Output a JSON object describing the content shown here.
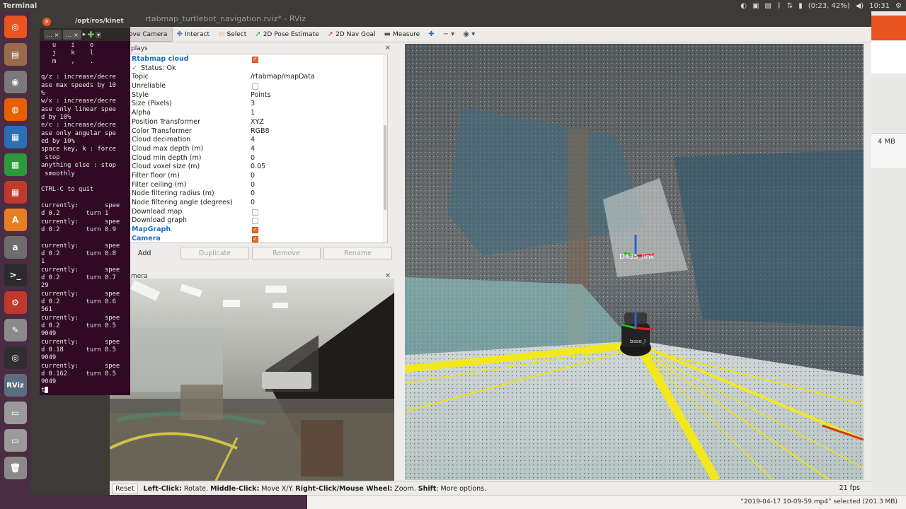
{
  "top_panel": {
    "app_name": "Terminal",
    "battery": "(0:23, 42%)",
    "clock": "10:31"
  },
  "launcher": {
    "items": [
      {
        "name": "ubuntu-logo-icon",
        "glyph": "◎",
        "color": "#e95420"
      },
      {
        "name": "files-icon",
        "glyph": "▤",
        "color": "#9a6b4b"
      },
      {
        "name": "screenshot-icon",
        "glyph": "◉",
        "color": "#7a7a7a"
      },
      {
        "name": "firefox-icon",
        "glyph": "◍",
        "color": "#e66000"
      },
      {
        "name": "writer-icon",
        "glyph": "▦",
        "color": "#2a6fb5"
      },
      {
        "name": "calc-icon",
        "glyph": "▦",
        "color": "#2c9a3a"
      },
      {
        "name": "impress-icon",
        "glyph": "▦",
        "color": "#c0392b"
      },
      {
        "name": "software-center-icon",
        "glyph": "A",
        "color": "#e67e22"
      },
      {
        "name": "amazon-icon",
        "glyph": "a",
        "color": "#6d6d6d"
      },
      {
        "name": "terminal-icon",
        "glyph": ">_",
        "color": "#2c2c2c"
      },
      {
        "name": "settings-icon",
        "glyph": "⚙",
        "color": "#c0392b"
      },
      {
        "name": "text-editor-icon",
        "glyph": "✎",
        "color": "#8a8a8a"
      },
      {
        "name": "obs-icon",
        "glyph": "◎",
        "color": "#302e31"
      },
      {
        "name": "rviz-icon",
        "glyph": "RViz",
        "color": "#5a6e7f"
      },
      {
        "name": "drive-icon",
        "glyph": "▭",
        "color": "#9a9a9a"
      },
      {
        "name": "drive-2-icon",
        "glyph": "▭",
        "color": "#9a9a9a"
      },
      {
        "name": "trash-icon",
        "glyph": "🗑",
        "color": "#8a8a8a"
      }
    ]
  },
  "desktop": {
    "file_size": "4 MB",
    "status_message": "“2019-04-17 10-09-59.mp4” selected (201.3 MB)"
  },
  "rviz": {
    "title": "rtabmap_turtlebot_navigation.rviz* - RViz",
    "toolbar": {
      "move_camera": "ove Camera",
      "interact": "Interact",
      "select": "Select",
      "pose_estimate": "2D Pose Estimate",
      "nav_goal": "2D Nav Goal",
      "measure": "Measure"
    },
    "displays": {
      "header": "plays",
      "rows": [
        {
          "key": "Rtabmap cloud",
          "value": "",
          "checkbox": "on",
          "style": "blue"
        },
        {
          "key": "Status: Ok",
          "value": "",
          "checkbox": "",
          "style": "status"
        },
        {
          "key": "Topic",
          "value": "/rtabmap/mapData",
          "checkbox": "",
          "style": ""
        },
        {
          "key": "Unreliable",
          "value": "",
          "checkbox": "off",
          "style": ""
        },
        {
          "key": "Style",
          "value": "Points",
          "checkbox": "",
          "style": ""
        },
        {
          "key": "Size (Pixels)",
          "value": "3",
          "checkbox": "",
          "style": ""
        },
        {
          "key": "Alpha",
          "value": "1",
          "checkbox": "",
          "style": ""
        },
        {
          "key": "Position Transformer",
          "value": "XYZ",
          "checkbox": "",
          "style": ""
        },
        {
          "key": "Color Transformer",
          "value": "RGB8",
          "checkbox": "",
          "style": ""
        },
        {
          "key": "Cloud decimation",
          "value": "4",
          "checkbox": "",
          "style": ""
        },
        {
          "key": "Cloud max depth (m)",
          "value": "4",
          "checkbox": "",
          "style": ""
        },
        {
          "key": "Cloud min depth (m)",
          "value": "0",
          "checkbox": "",
          "style": ""
        },
        {
          "key": "Cloud voxel size (m)",
          "value": "0.05",
          "checkbox": "",
          "style": ""
        },
        {
          "key": "Filter floor (m)",
          "value": "0",
          "checkbox": "",
          "style": ""
        },
        {
          "key": "Filter ceiling (m)",
          "value": "0",
          "checkbox": "",
          "style": ""
        },
        {
          "key": "Node filtering radius (m)",
          "value": "0",
          "checkbox": "",
          "style": ""
        },
        {
          "key": "Node filtering angle (degrees)",
          "value": "0",
          "checkbox": "",
          "style": ""
        },
        {
          "key": "Download map",
          "value": "",
          "checkbox": "off",
          "style": ""
        },
        {
          "key": "Download graph",
          "value": "",
          "checkbox": "off",
          "style": ""
        },
        {
          "key": "MapGraph",
          "value": "",
          "checkbox": "on",
          "style": "blue"
        },
        {
          "key": "Camera",
          "value": "",
          "checkbox": "on",
          "style": "blue"
        }
      ],
      "buttons": {
        "add": "Add",
        "duplicate": "Duplicate",
        "remove": "Remove",
        "rename": "Rename"
      }
    },
    "camera_panel": {
      "header": "mera"
    },
    "view3d": {
      "frame_label": "D435_link",
      "base_label": "base_l"
    },
    "status_bar": {
      "reset": "Reset",
      "hint_parts": [
        {
          "bold": "Left-Click:",
          "text": " Rotate. "
        },
        {
          "bold": "Middle-Click:",
          "text": " Move X/Y. "
        },
        {
          "bold": "Right-Click/Mouse Wheel:",
          "text": " Zoom. "
        },
        {
          "bold": "Shift",
          "text": ": More options."
        }
      ],
      "fps": "21 fps"
    }
  },
  "terminal": {
    "title": "/opt/ros/kinet",
    "tab1": "...",
    "tab2": "...",
    "lines": "   u    i    o\n   j    k    l\n   m    ,    .\n\nq/z : increase/decre\nase max speeds by 10\n%\nw/x : increase/decre\nase only linear spee\nd by 10%\ne/c : increase/decre\nase only angular spe\ned by 10%\nspace key, k : force\n stop\nanything else : stop\n smoothly\n\nCTRL-C to quit\n\ncurrently:       spee\nd 0.2       turn 1\ncurrently:       spee\nd 0.2       turn 0.9\n\ncurrently:       spee\nd 0.2       turn 0.8\n1\ncurrently:       spee\nd 0.2       turn 0.7\n29\ncurrently:       spee\nd 0.2       turn 0.6\n561\ncurrently:       spee\nd 0.2       turn 0.5\n9049\ncurrently:       spee\nd 0.18      turn 0.5\n9049\ncurrently:       spee\nd 0.162     turn 0.5\n9049\nt"
  }
}
